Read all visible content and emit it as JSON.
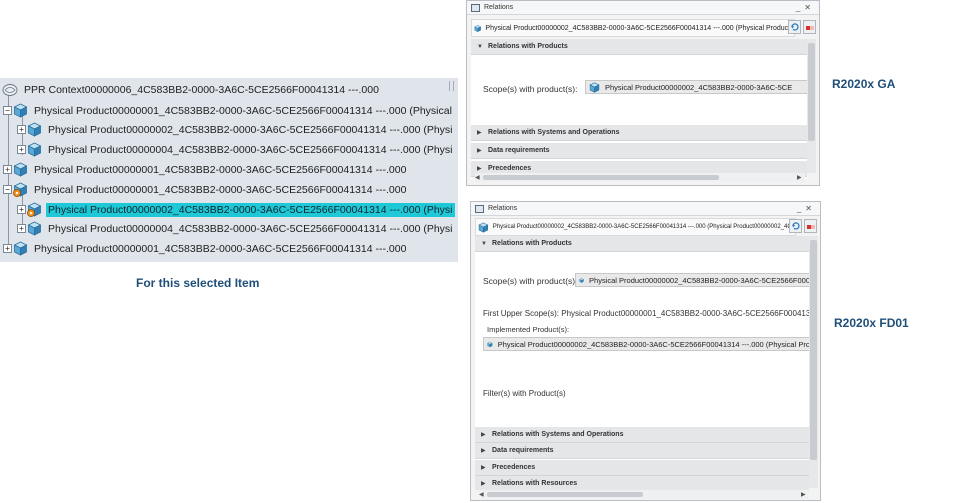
{
  "tree": {
    "root_label": "PPR Context00000006_4C583BB2-0000-3A6C-5CE2566F00041314 ---.000",
    "rows": [
      {
        "label": "Physical Product00000001_4C583BB2-0000-3A6C-5CE2566F00041314 ---.000 (Physical"
      },
      {
        "label": "Physical Product00000002_4C583BB2-0000-3A6C-5CE2566F00041314 ---.000 (Physi"
      },
      {
        "label": "Physical Product00000004_4C583BB2-0000-3A6C-5CE2566F00041314 ---.000 (Physi"
      },
      {
        "label": "Physical Product00000001_4C583BB2-0000-3A6C-5CE2566F00041314 ---.000"
      },
      {
        "label": "Physical Product00000001_4C583BB2-0000-3A6C-5CE2566F00041314 ---.000"
      },
      {
        "label": "Physical Product00000002_4C583BB2-0000-3A6C-5CE2566F00041314 ---.000 (Physi"
      },
      {
        "label": "Physical Product00000004_4C583BB2-0000-3A6C-5CE2566F00041314 ---.000 (Physi"
      },
      {
        "label": "Physical Product00000001_4C583BB2-0000-3A6C-5CE2566F00041314 ---.000"
      }
    ],
    "caption": "For this selected Item"
  },
  "ga_window": {
    "title": "Relations",
    "path": "Physical Product00000002_4C583BB2-0000-3A6C-5CE2566F00041314 ---.000 (Physical Product0",
    "section_products": "Relations with Products",
    "scope_label": "Scope(s) with product(s):",
    "scope_value": "Physical Product00000002_4C583BB2-0000-3A6C-5CE",
    "section_systems": "Relations with Systems and Operations",
    "section_data": "Data requirements",
    "section_precedences": "Precedences",
    "version_label": "R2020x GA"
  },
  "fd_window": {
    "title": "Relations",
    "path": "Physical Product00000002_4C583BB2-0000-3A6C-5CE2566F00041314 ---.000 (Physical Product00000002_4C5",
    "section_products": "Relations with Products",
    "scope_label": "Scope(s) with product(s):",
    "scope_value": "Physical Product00000002_4C583BB2-0000-3A6C-5CE2566F000",
    "upper_scope": "First Upper Scope(s): Physical Product00000001_4C583BB2-0000-3A6C-5CE2566F00041314 -",
    "implemented_label": "Implemented Product(s):",
    "implemented_value": "Physical Product00000002_4C583BB2-0000-3A6C-5CE2566F00041314 ---.000 (Physical Pro",
    "filters_label": "Filter(s) with Product(s)",
    "section_systems": "Relations with Systems and Operations",
    "section_data": "Data requirements",
    "section_precedences": "Precedences",
    "section_resources": "Relations with Resources",
    "version_label": "R2020x FD01"
  },
  "colors": {
    "selection": "#1fc8d6",
    "caption": "#1f4e79",
    "tree_bg": "#dfe5ea"
  }
}
